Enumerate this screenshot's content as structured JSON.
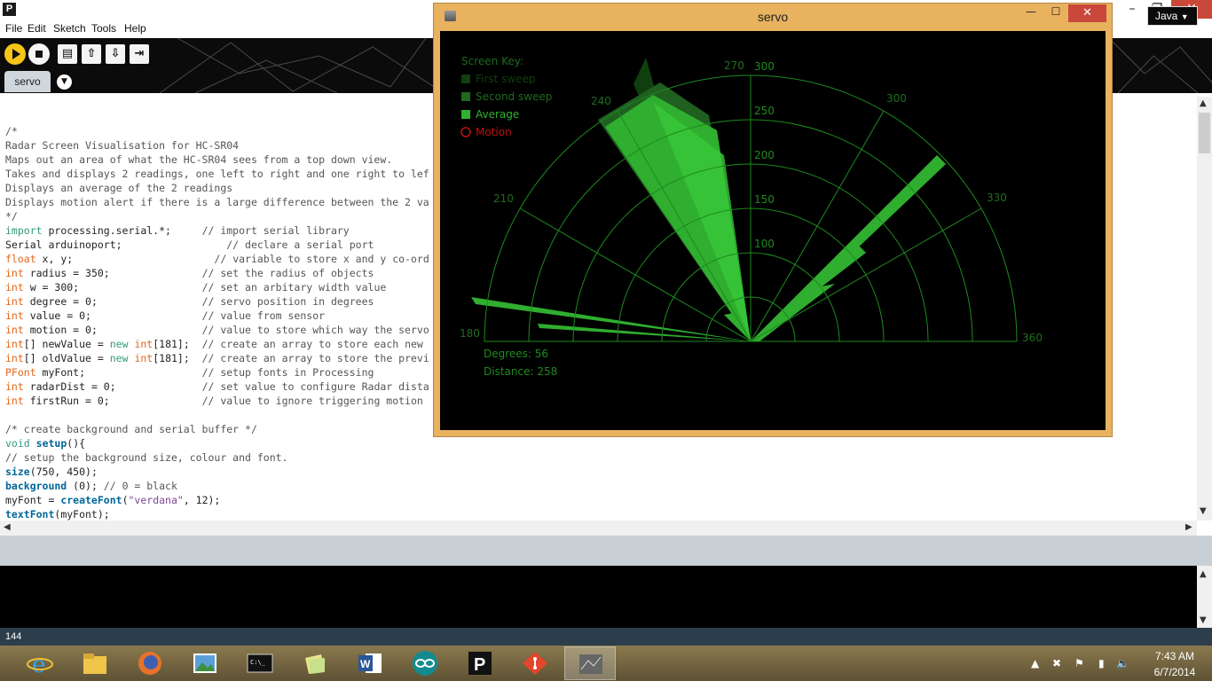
{
  "ide": {
    "logo": "P",
    "menus": [
      "File",
      "Edit",
      "Sketch",
      "Tools",
      "Help"
    ],
    "mode": "Java",
    "tab": "servo",
    "status_line": "144"
  },
  "code_lines": [
    "/*",
    "Radar Screen Visualisation for HC-SR04",
    "Maps out an area of what the HC-SR04 sees from a top down view.",
    "Takes and displays 2 readings, one left to right and one right to lef",
    "Displays an average of the 2 readings",
    "Displays motion alert if there is a large difference between the 2 va",
    "*/",
    "import processing.serial.*;     // import serial library",
    "Serial arduinoport;                 // declare a serial port",
    "float x, y;                       // variable to store x and y co-ord",
    "int radius = 350;               // set the radius of objects",
    "int w = 300;                    // set an arbitary width value",
    "int degree = 0;                 // servo position in degrees",
    "int value = 0;                  // value from sensor",
    "int motion = 0;                 // value to store which way the servo",
    "int[] newValue = new int[181];  // create an array to store each new",
    "int[] oldValue = new int[181];  // create an array to store the previ",
    "PFont myFont;                   // setup fonts in Processing",
    "int radarDist = 0;              // set value to configure Radar dista",
    "int firstRun = 0;               // value to ignore triggering motion",
    "",
    "/* create background and serial buffer */",
    "void setup(){",
    "// setup the background size, colour and font.",
    "size(750, 450);",
    "background (0); // 0 = black",
    "myFont = createFont(\"verdana\", 12);",
    "textFont(myFont);"
  ],
  "servo_window": {
    "title": "servo",
    "screen_key_title": "Screen Key:",
    "keys": [
      {
        "label": "First sweep",
        "color": "#0f3f0f"
      },
      {
        "label": "Second sweep",
        "color": "#1e6a1e"
      },
      {
        "label": "Average",
        "color": "#2fb32f"
      },
      {
        "label": "Motion",
        "color": "#c01010"
      }
    ],
    "degree_labels": [
      "180",
      "210",
      "240",
      "270",
      "300",
      "330",
      "360"
    ],
    "distance_labels": [
      "100",
      "150",
      "200",
      "250",
      "300"
    ],
    "readout_degrees": "Degrees: 56",
    "readout_distance": "Distance: 258"
  },
  "taskbar": {
    "time": "7:43 AM",
    "date": "6/7/2014",
    "apps": [
      "internet-explorer",
      "file-explorer",
      "firefox",
      "photos",
      "command-prompt",
      "sticky-notes",
      "word",
      "arduino",
      "processing",
      "git",
      "servo-sketch"
    ]
  }
}
